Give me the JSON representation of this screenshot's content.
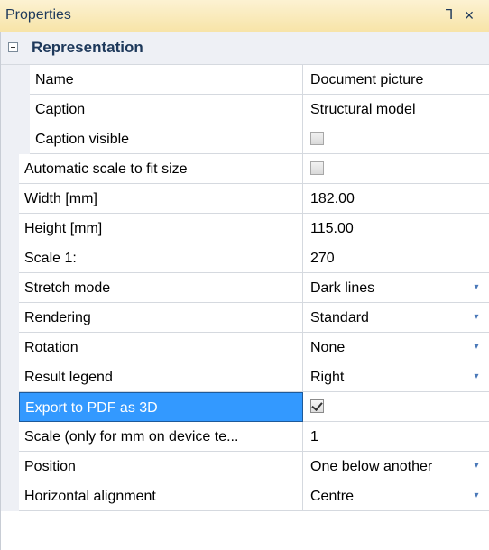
{
  "panel": {
    "title": "Properties",
    "pin_glyph": "⅂",
    "close_glyph": "×"
  },
  "category": {
    "label": "Representation"
  },
  "rows": [
    {
      "name": "Name",
      "value": "Document picture"
    },
    {
      "name": "Caption",
      "value": "Structural model"
    },
    {
      "name": "Caption visible",
      "value": "",
      "checked": false
    },
    {
      "name": "Automatic scale to fit size",
      "value": "",
      "checked": false
    },
    {
      "name": "Width [mm]",
      "value": "182.00"
    },
    {
      "name": "Height [mm]",
      "value": "115.00"
    },
    {
      "name": "Scale 1:",
      "value": "270"
    },
    {
      "name": "Stretch mode",
      "value": "Dark lines"
    },
    {
      "name": "Rendering",
      "value": "Standard"
    },
    {
      "name": "Rotation",
      "value": "None"
    },
    {
      "name": "Result legend",
      "value": "Right"
    },
    {
      "name": "Export to PDF as 3D",
      "value": "",
      "checked": true
    },
    {
      "name": "Scale (only for mm on device te...",
      "value": "1"
    },
    {
      "name": "Position",
      "value": "One below another"
    },
    {
      "name": "Horizontal alignment",
      "value": "Centre"
    }
  ],
  "icons": {
    "dropdown": "▾"
  }
}
